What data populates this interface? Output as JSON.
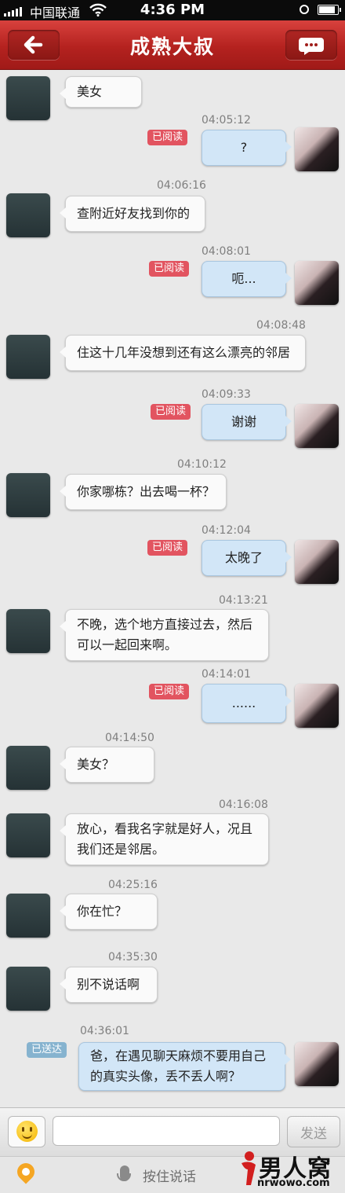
{
  "status_bar": {
    "carrier": "中国联通",
    "time": "4:36 PM"
  },
  "header": {
    "title": "成熟大叔"
  },
  "messages": [
    {
      "dir": "in",
      "time": "",
      "text": "美女"
    },
    {
      "dir": "out",
      "time": "04:05:12",
      "text": "?",
      "status": "已阅读"
    },
    {
      "dir": "in",
      "time": "04:06:16",
      "text": "查附近好友找到你的"
    },
    {
      "dir": "out",
      "time": "04:08:01",
      "text": "呃...",
      "status": "已阅读"
    },
    {
      "dir": "in",
      "time": "04:08:48",
      "text": "住这十几年没想到还有这么漂亮的邻居"
    },
    {
      "dir": "out",
      "time": "04:09:33",
      "text": "谢谢",
      "status": "已阅读"
    },
    {
      "dir": "in",
      "time": "04:10:12",
      "text": "你家哪栋？出去喝一杯？"
    },
    {
      "dir": "out",
      "time": "04:12:04",
      "text": "太晚了",
      "status": "已阅读"
    },
    {
      "dir": "in",
      "time": "04:13:21",
      "text": "不晚，选个地方直接过去，然后可以一起回来啊。"
    },
    {
      "dir": "out",
      "time": "04:14:01",
      "text": "......",
      "status": "已阅读"
    },
    {
      "dir": "in",
      "time": "04:14:50",
      "text": "美女？"
    },
    {
      "dir": "in",
      "time": "04:16:08",
      "text": "放心，看我名字就是好人，况且我们还是邻居。"
    },
    {
      "dir": "in",
      "time": "04:25:16",
      "text": "你在忙？"
    },
    {
      "dir": "in",
      "time": "04:35:30",
      "text": "别不说话啊"
    },
    {
      "dir": "out",
      "time": "04:36:01",
      "text": "爸，在遇见聊天麻烦不要用自己的真实头像，丢不丢人啊？",
      "status": "已送达"
    }
  ],
  "input": {
    "value": "",
    "placeholder": "",
    "send_label": "发送"
  },
  "bottom": {
    "voice_label": "按住说话"
  },
  "watermark": {
    "main": "男人窝",
    "sub": "nrwowo.com"
  },
  "colors": {
    "nav_red": "#b4221f",
    "read_badge": "#e25460",
    "sent_badge": "#86b3cf",
    "out_bubble": "#d2e6f7"
  },
  "icons": [
    "back-arrow-icon",
    "chat-bubble-icon",
    "emoji-icon",
    "location-icon",
    "microphone-icon",
    "wifi-icon",
    "clock-icon",
    "battery-icon"
  ]
}
